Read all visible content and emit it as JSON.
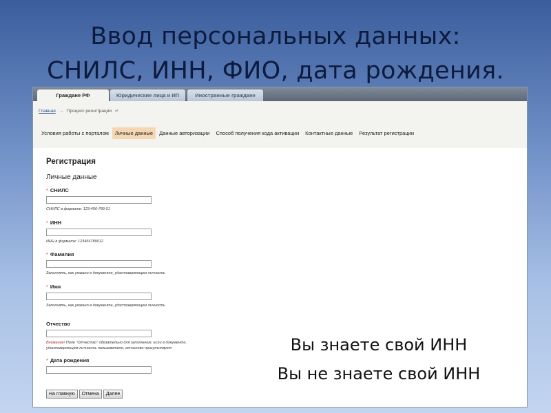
{
  "slide": {
    "title_line1": "Ввод персональных данных:",
    "title_line2": "СНИЛС, ИНН, ФИО, дата рождения."
  },
  "tabs": [
    {
      "label": "Граждане РФ",
      "active": true
    },
    {
      "label": "Юридические лица и ИП",
      "active": false
    },
    {
      "label": "Иностранные граждане",
      "active": false
    }
  ],
  "breadcrumb": {
    "home": "Главная",
    "current": "Процесс регистрации"
  },
  "steps": [
    {
      "label": "Условия работы с порталом",
      "active": false
    },
    {
      "label": "Личные данные",
      "active": true
    },
    {
      "label": "Данные авторизации",
      "active": false
    },
    {
      "label": "Способ получения кода активации",
      "active": false
    },
    {
      "label": "Контактные данные",
      "active": false
    },
    {
      "label": "Результат регистрации",
      "active": false
    }
  ],
  "form": {
    "title": "Регистрация",
    "subtitle": "Личные данные",
    "fields": {
      "snils": {
        "label": "СНИЛС",
        "required": true,
        "value": "",
        "hint": "СНИЛС в формате: 123-456-789 01"
      },
      "inn": {
        "label": "ИНН",
        "required": true,
        "value": "",
        "hint": "ИНН в формате: 123456789012"
      },
      "surname": {
        "label": "Фамилия",
        "required": true,
        "value": "",
        "hint": "Заполнять, как указано в документе, удостоверяющем личность"
      },
      "name": {
        "label": "Имя",
        "required": true,
        "value": "",
        "hint": "Заполнять, как указано в документе, удостоверяющем личность"
      },
      "patronymic": {
        "label": "Отчество",
        "required": false,
        "value": "",
        "hint_warn": "Внимание!",
        "hint_line1": " Поле \"Отчество\" обязательно для заполнения, если в документе,",
        "hint_line2": "удостоверяющем личность пользователя, отчество присутствует"
      },
      "birthdate": {
        "label": "Дата рождения",
        "required": true,
        "value": ""
      }
    },
    "required_mark": "*",
    "buttons": {
      "home": "На главную",
      "cancel": "Отмена",
      "next": "Далее"
    }
  },
  "overlay": {
    "line1": "Вы знаете свой ИНН",
    "line2": "Вы не знаете свой ИНН"
  }
}
